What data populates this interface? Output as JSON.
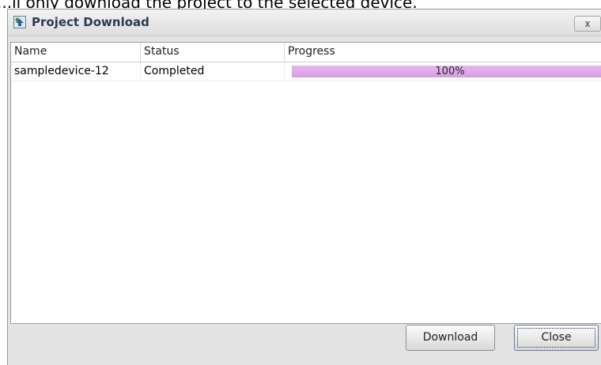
{
  "background_text": "...ll only download the project to the selected device.",
  "dialog": {
    "title": "Project Download",
    "close_label": "x",
    "columns": [
      "Name",
      "Status",
      "Progress"
    ],
    "rows": [
      {
        "name": "sampledevice-12",
        "status": "Completed",
        "progress_label": "100%",
        "progress": 1.0
      }
    ],
    "buttons": {
      "download": "Download",
      "close": "Close"
    }
  },
  "colors": {
    "progress_fill": "#d69be3",
    "title_text": "#2b3a4e"
  },
  "icons": {
    "app_icon": "project-download-icon",
    "close_icon": "close-icon"
  }
}
